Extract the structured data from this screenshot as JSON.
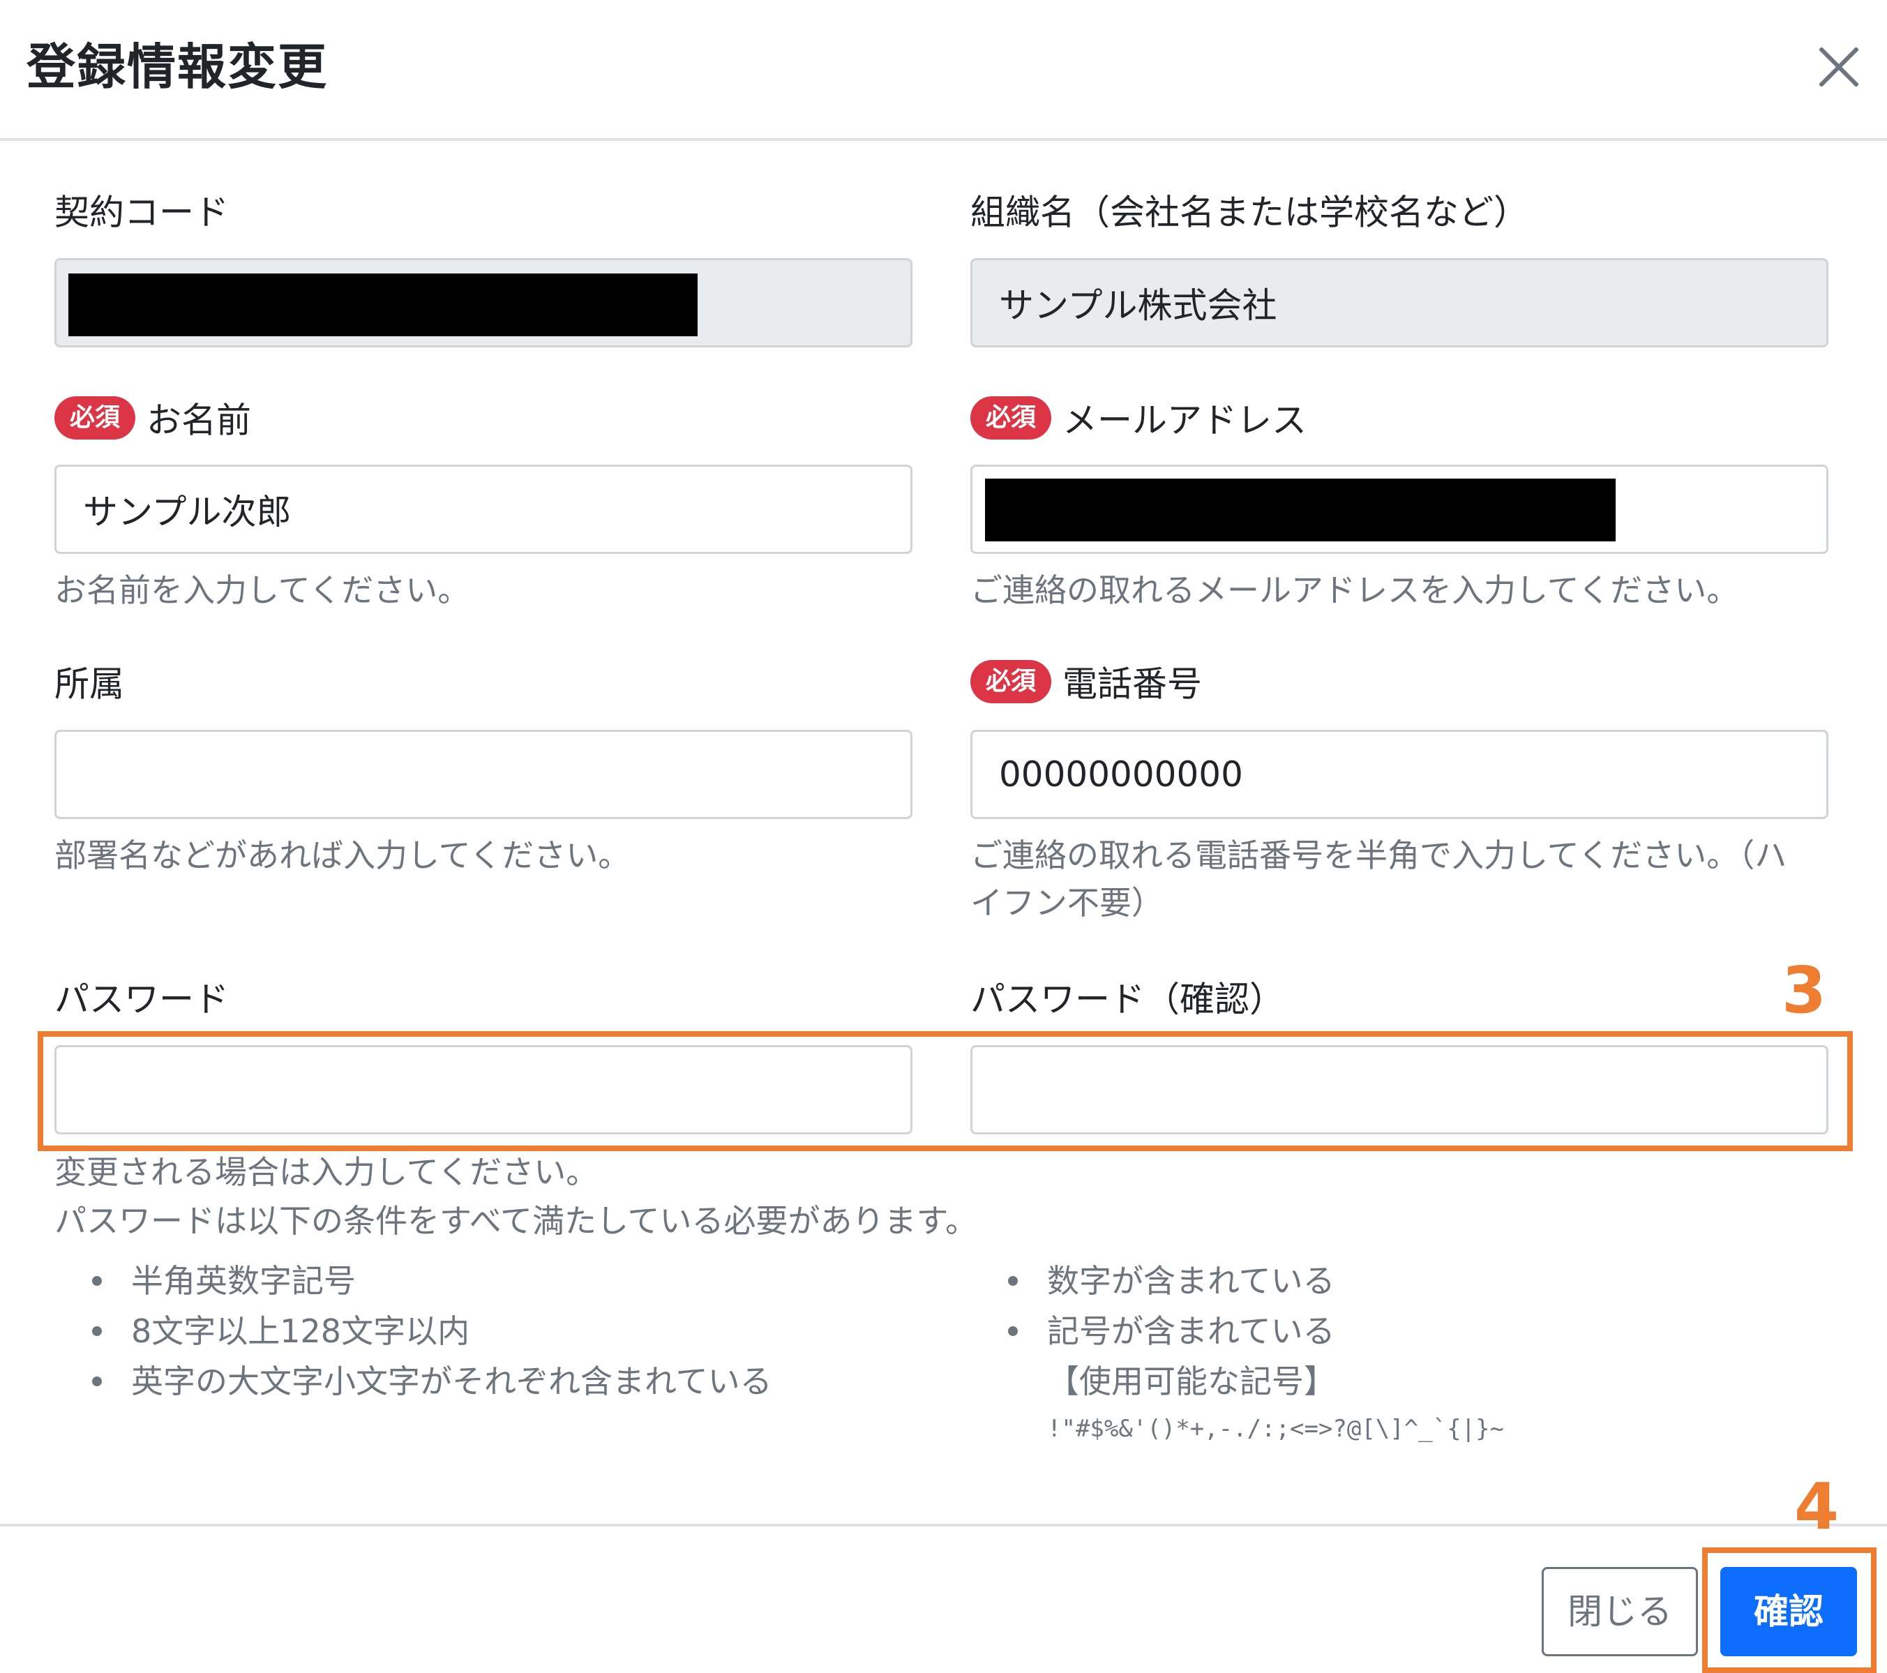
{
  "modal": {
    "title": "登録情報変更"
  },
  "form": {
    "contract_code": {
      "label": "契約コード",
      "value": ""
    },
    "organization": {
      "label": "組織名（会社名または学校名など）",
      "value": "サンプル株式会社"
    },
    "required_badge": "必須",
    "name": {
      "label": "お名前",
      "value": "サンプル次郎",
      "help": "お名前を入力してください。"
    },
    "email": {
      "label": "メールアドレス",
      "value": "",
      "help": "ご連絡の取れるメールアドレスを入力してください。"
    },
    "department": {
      "label": "所属",
      "value": "",
      "help": "部署名などがあれば入力してください。"
    },
    "phone": {
      "label": "電話番号",
      "value": "00000000000",
      "help": "ご連絡の取れる電話番号を半角で入力してください。（ハイフン不要）"
    },
    "password": {
      "label": "パスワード",
      "value": ""
    },
    "password_confirm": {
      "label": "パスワード（確認）",
      "value": ""
    },
    "password_help": {
      "line1": "変更される場合は入力してください。",
      "line2": "パスワードは以下の条件をすべて満たしている必要があります。",
      "rules_left": [
        "半角英数字記号",
        "8文字以上128文字以内",
        "英字の大文字小文字がそれぞれ含まれている"
      ],
      "rules_right": [
        "数字が含まれている",
        "記号が含まれている"
      ],
      "symbols_heading": "【使用可能な記号】",
      "symbols": "!\"#$%&'()*+,-./:;<=>?@[\\]^_`{|}~"
    }
  },
  "annotations": {
    "step3": "3",
    "step4": "4",
    "highlight_color": "#ed7d31"
  },
  "footer": {
    "close_label": "閉じる",
    "confirm_label": "確認"
  },
  "colors": {
    "primary": "#0d6efd",
    "danger": "#dc3545",
    "muted": "#6c757d",
    "readonly_bg": "#e9ecef"
  }
}
